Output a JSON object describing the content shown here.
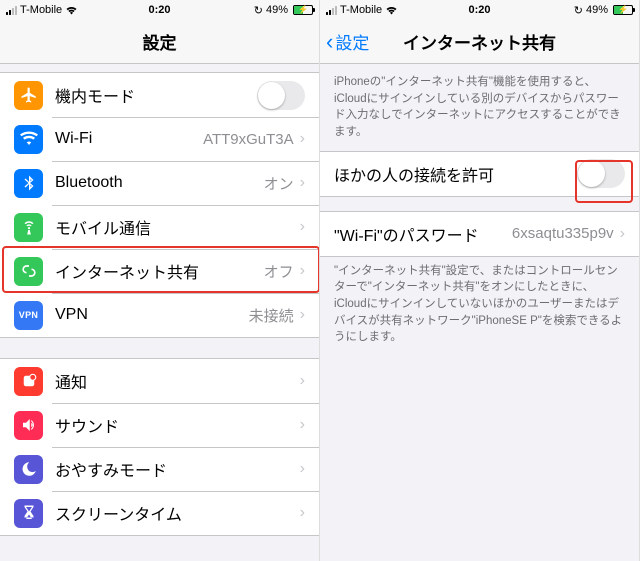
{
  "status": {
    "carrier": "T-Mobile",
    "time": "0:20",
    "battery_pct": "49%"
  },
  "left": {
    "title": "設定",
    "items": {
      "airplane": {
        "label": "機内モード"
      },
      "wifi": {
        "label": "Wi-Fi",
        "value": "ATT9xGuT3A"
      },
      "bluetooth": {
        "label": "Bluetooth",
        "value": "オン"
      },
      "cellular": {
        "label": "モバイル通信"
      },
      "hotspot": {
        "label": "インターネット共有",
        "value": "オフ"
      },
      "vpn": {
        "label": "VPN",
        "value": "未接続"
      },
      "notifications": {
        "label": "通知"
      },
      "sounds": {
        "label": "サウンド"
      },
      "dnd": {
        "label": "おやすみモード"
      },
      "screentime": {
        "label": "スクリーンタイム"
      }
    },
    "vpn_icon_text": "VPN"
  },
  "right": {
    "back": "設定",
    "title": "インターネット共有",
    "intro": "iPhoneの\"インターネット共有\"機能を使用すると、iCloudにサインインしている別のデバイスからパスワード入力なしでインターネットにアクセスすることができます。",
    "allow_others": {
      "label": "ほかの人の接続を許可"
    },
    "wifi_pw": {
      "label": "\"Wi-Fi\"のパスワード",
      "value": "6xsaqtu335p9v"
    },
    "footer": "\"インターネット共有\"設定で、またはコントロールセンターで\"インターネット共有\"をオンにしたときに、iCloudにサインインしていないほかのユーザーまたはデバイスが共有ネットワーク\"iPhoneSE P\"を検索できるようにします。"
  },
  "recharge_icon": "↻"
}
